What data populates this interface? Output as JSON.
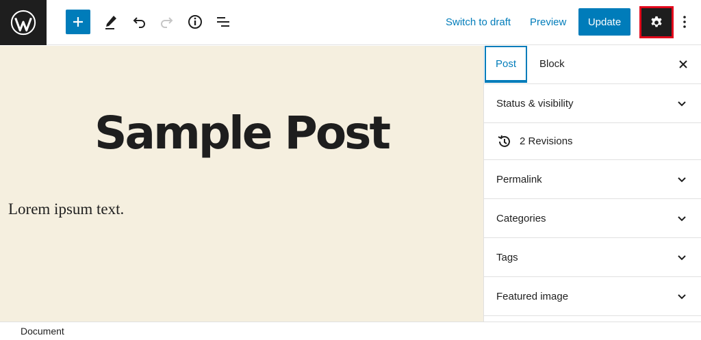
{
  "toolbar": {
    "switch_to_draft": "Switch to draft",
    "preview": "Preview",
    "update": "Update"
  },
  "post": {
    "title": "Sample Post",
    "paragraph": "Lorem ipsum text."
  },
  "sidebar": {
    "tabs": [
      {
        "label": "Post",
        "active": true
      },
      {
        "label": "Block",
        "active": false
      }
    ],
    "panels": {
      "status": "Status & visibility",
      "revisions": "2 Revisions",
      "permalink": "Permalink",
      "categories": "Categories",
      "tags": "Tags",
      "featured_image": "Featured image"
    }
  },
  "footer": {
    "breadcrumb": "Document"
  },
  "colors": {
    "accent": "#007cba",
    "canvas": "#f5efdf",
    "dark": "#1e1e1e",
    "highlight": "#e2061b"
  }
}
